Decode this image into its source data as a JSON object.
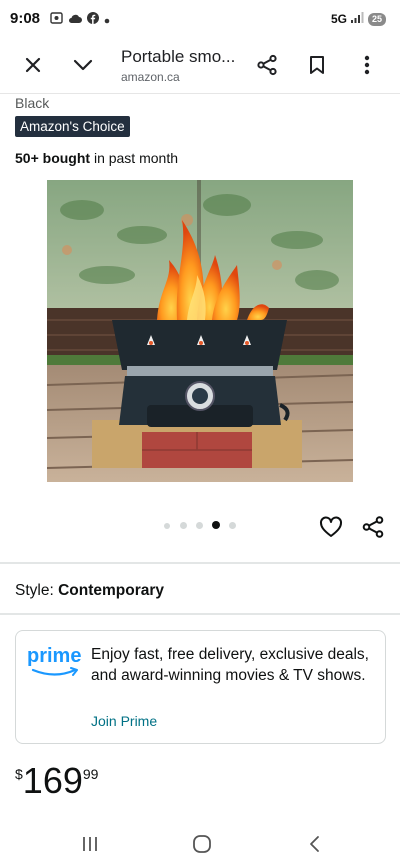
{
  "status_bar": {
    "time": "9:08",
    "network": "5G",
    "battery": "25",
    "icons": [
      "screenshot-icon",
      "cloud-icon",
      "facebook-icon",
      "dot-icon"
    ]
  },
  "header": {
    "title": "Portable smo...",
    "domain": "amazon.ca",
    "icons": [
      "close-icon",
      "chevron-down-icon",
      "share-icon",
      "bookmark-icon",
      "more-vertical-icon"
    ]
  },
  "product": {
    "color": "Black",
    "badge": "Amazon's Choice",
    "bought_bold": "50+ bought",
    "bought_rest": " in past month",
    "image_alt": "portable-fire-pit-photo"
  },
  "carousel": {
    "total": 5,
    "active_index": 3
  },
  "style": {
    "label": "Style: ",
    "value": "Contemporary"
  },
  "prime": {
    "logo_text": "prime",
    "description": "Enjoy fast, free delivery, exclusive deals, and award-winning movies & TV shows.",
    "link": "Join Prime"
  },
  "price": {
    "symbol": "$",
    "whole": "169",
    "fraction": "99"
  },
  "colors": {
    "badge_bg": "#232f3e",
    "prime_blue": "#1a98ff",
    "link": "#007185",
    "text": "#0f1111"
  }
}
